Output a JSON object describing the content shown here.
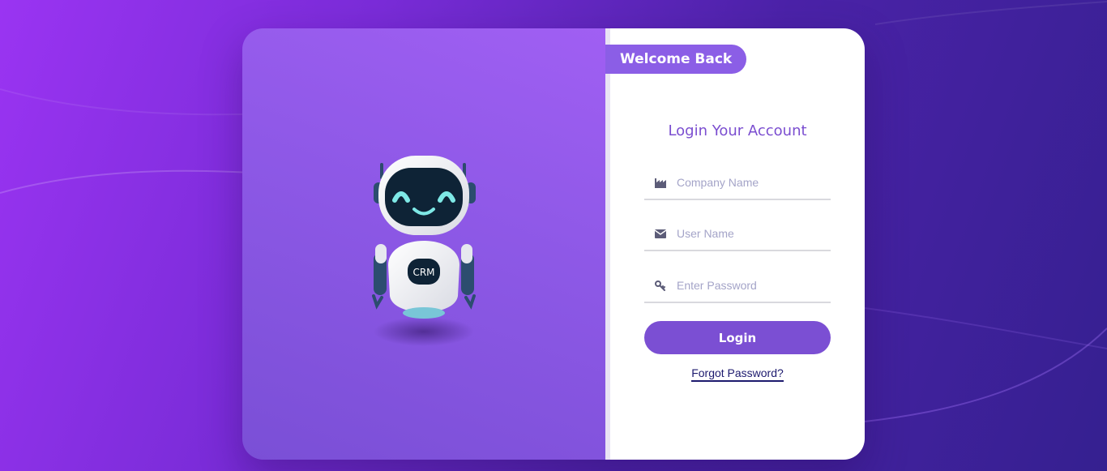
{
  "welcome": {
    "label": "Welcome Back"
  },
  "form": {
    "title": "Login Your Account",
    "company": {
      "placeholder": "Company Name",
      "value": "",
      "icon": "factory-icon"
    },
    "username": {
      "placeholder": "User Name",
      "value": "",
      "icon": "envelope-icon"
    },
    "password": {
      "placeholder": "Enter Password",
      "value": "",
      "icon": "key-icon"
    },
    "login_label": "Login",
    "forgot_label": "Forgot Password?"
  },
  "mascot": {
    "badge": "CRM"
  },
  "colors": {
    "accent": "#7b4fd3",
    "title": "#7b4ed0",
    "link": "#1d1a6e",
    "placeholder": "#a4a4c8"
  }
}
